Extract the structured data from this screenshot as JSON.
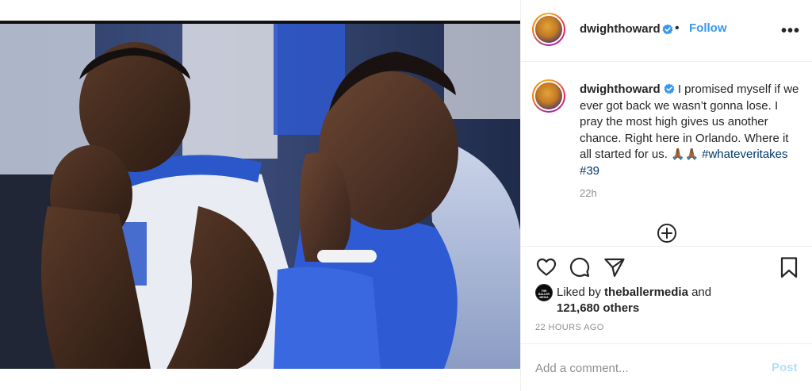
{
  "post": {
    "username": "dwighthoward",
    "follow_label": "Follow",
    "more_label": "•••",
    "separator": "•"
  },
  "caption": {
    "username": "dwighthoward",
    "text": "I promised myself if we ever got back we wasn’t gonna lose. I pray the most high gives us another chance. Right here in Orlando. Where it all started for us.",
    "emoji": "🙏🏾🙏🏾",
    "hashtags": "#whateveritakes #39",
    "age": "22h"
  },
  "likes": {
    "avatar_text": "THE BALLER MEDIA",
    "prefix": "Liked by",
    "user": "theballermedia",
    "connector": "and",
    "others": "121,680 others"
  },
  "timestamp": "22 HOURS AGO",
  "comment": {
    "placeholder": "Add a comment...",
    "post_label": "Post"
  },
  "icons": {
    "verified": "verified-badge-icon",
    "more": "more-options-icon",
    "add": "plus-circle-icon",
    "like": "heart-icon",
    "comment": "comment-bubble-icon",
    "share": "paper-plane-icon",
    "save": "bookmark-icon"
  },
  "colors": {
    "link_blue": "#3897f0",
    "hashtag": "#00376b",
    "muted": "#8e8e8e",
    "post_disabled": "#b2dffc"
  }
}
